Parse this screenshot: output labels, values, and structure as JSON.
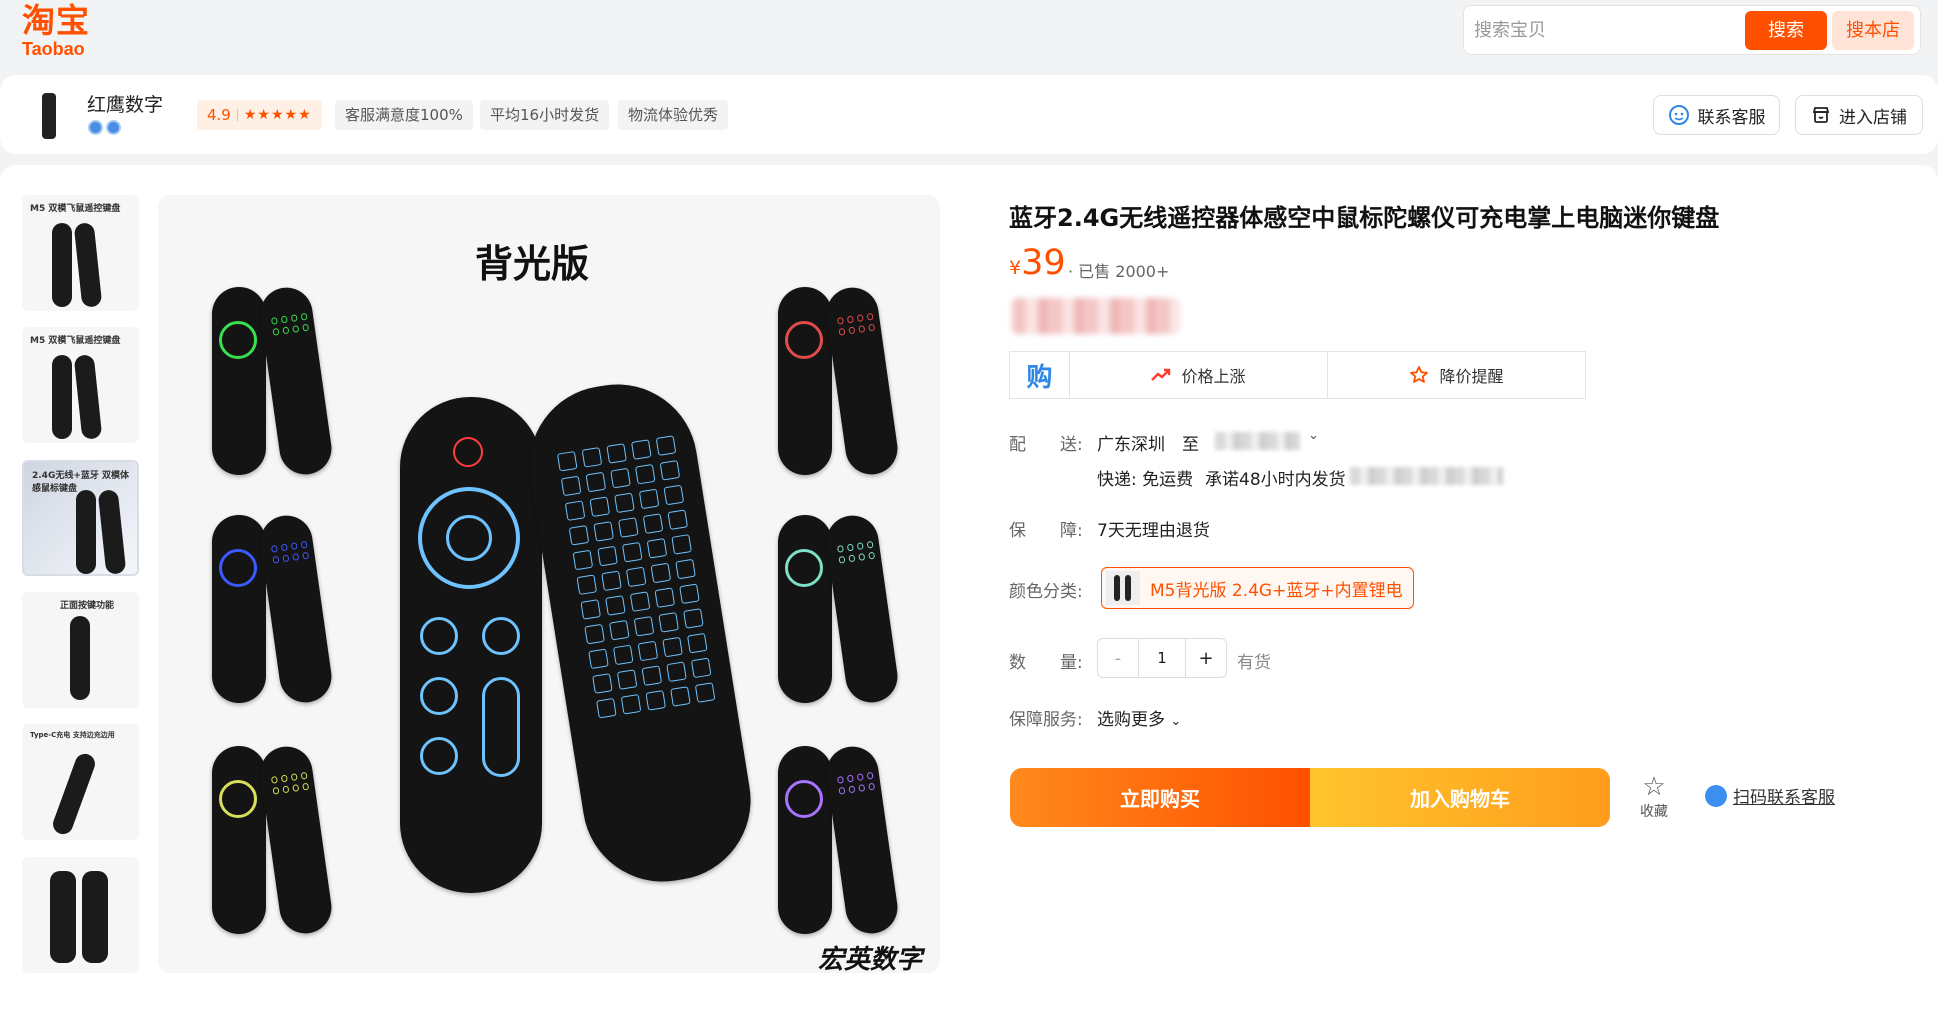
{
  "header": {
    "logo_cn": "淘宝",
    "logo_en": "Taobao",
    "search_placeholder": "搜索宝贝",
    "search_button": "搜索",
    "shop_search_button": "搜本店"
  },
  "store": {
    "name": "红鹰数字",
    "rating": "4.9",
    "stars": "★★★★★",
    "tags": [
      "客服满意度100%",
      "平均16小时发货",
      "物流体验优秀"
    ],
    "contact_button": "联系客服",
    "enter_shop_button": "进入店铺"
  },
  "gallery": {
    "thumbnails": [
      {
        "caption": "M5 双模飞鼠遥控键盘"
      },
      {
        "caption": "M5 双模飞鼠遥控键盘"
      },
      {
        "caption": "2.4G无线+蓝牙 双模体感鼠标键盘"
      },
      {
        "caption": "正面按键功能"
      },
      {
        "caption": "Type-C充电 支持边充边用"
      },
      {
        "caption": ""
      }
    ],
    "main_title": "背光版",
    "watermark": "宏英数字"
  },
  "product": {
    "title": "蓝牙2.4G无线遥控器体感空中鼠标陀螺仪可充电掌上电脑迷你键盘",
    "currency": "¥",
    "price": "39",
    "sold": "· 已售 2000+",
    "price_tools": {
      "gou_icon": "购",
      "price_rise": "价格上涨",
      "price_alert": "降价提醒"
    },
    "delivery_label": "配　　送:",
    "delivery_from": "广东深圳",
    "delivery_to": "至",
    "express": "快递: 免运费",
    "promise": "承诺48小时内发货",
    "guarantee_label": "保　　障:",
    "guarantee": "7天无理由退货",
    "color_label": "颜色分类:",
    "color_option": "M5背光版 2.4G+蓝牙+内置锂电",
    "qty_label": "数　　量:",
    "qty_minus": "-",
    "qty": "1",
    "qty_plus": "+",
    "stock": "有货",
    "service_label": "保障服务:",
    "service_value": "选购更多",
    "buy_now": "立即购买",
    "add_cart": "加入购物车",
    "favorite": "收藏",
    "qr_service": "扫码联系客服"
  },
  "colors": {
    "brand": "#ff5000",
    "accent_blue": "#2f86e6"
  }
}
